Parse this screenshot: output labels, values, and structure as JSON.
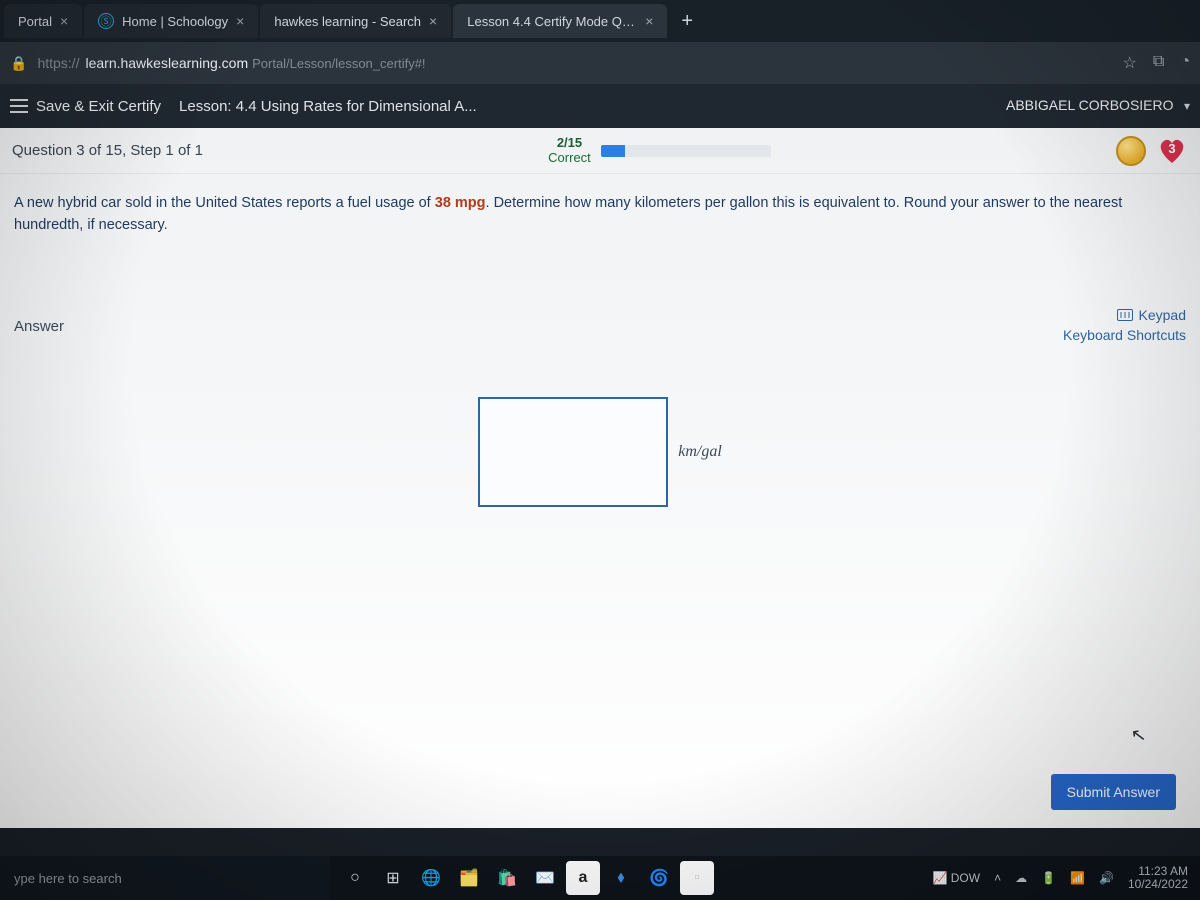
{
  "browser": {
    "tabs": [
      {
        "title": "Portal",
        "favicon": ""
      },
      {
        "title": "Home | Schoology",
        "favicon": "Ⓢ"
      },
      {
        "title": "hawkes learning - Search",
        "favicon": ""
      },
      {
        "title": "Lesson 4.4 Certify Mode Quest",
        "favicon": ""
      }
    ],
    "new_tab": "+",
    "url_domain": "learn.hawkeslearning.com",
    "url_path": "Portal/Lesson/lesson_certify#!"
  },
  "app_header": {
    "save_exit": "Save & Exit Certify",
    "lesson": "Lesson: 4.4 Using Rates for Dimensional A...",
    "user": "ABBIGAEL CORBOSIERO"
  },
  "progress": {
    "question_label": "Question 3 of 15, Step 1 of 1",
    "score_fraction": "2/15",
    "score_word": "Correct",
    "bar_percent": 14,
    "hearts": "3"
  },
  "problem": {
    "pre": "A new hybrid car sold in the United States reports a fuel usage of ",
    "mpg": "38 mpg",
    "post": ". Determine how many kilometers per gallon this is equivalent to. Round your answer to the nearest hundredth, if necessary."
  },
  "answer": {
    "label": "Answer",
    "keypad": "Keypad",
    "shortcuts": "Keyboard Shortcuts",
    "unit": "km/gal",
    "submit": "Submit Answer"
  },
  "taskbar": {
    "search_placeholder": "ype here to search",
    "stock": "DOW",
    "time": "11:23 AM",
    "date": "10/24/2022"
  }
}
